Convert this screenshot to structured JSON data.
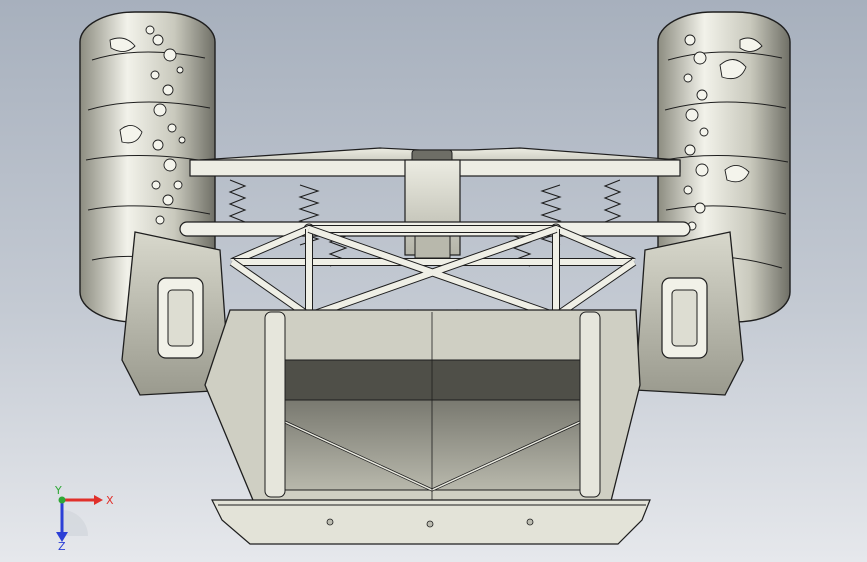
{
  "viewport": {
    "background_top": "#a7b0bd",
    "background_bottom": "#e6e8ec"
  },
  "model": {
    "shade_color": "#d9d9cc",
    "dark_color": "#5a5a52",
    "line_color": "#1e1e1e"
  },
  "triad": {
    "x_label": "X",
    "y_label": "Y",
    "z_label": "Z",
    "x_color": "#e0302a",
    "y_color": "#2fa836",
    "z_color": "#2b3fd6"
  }
}
